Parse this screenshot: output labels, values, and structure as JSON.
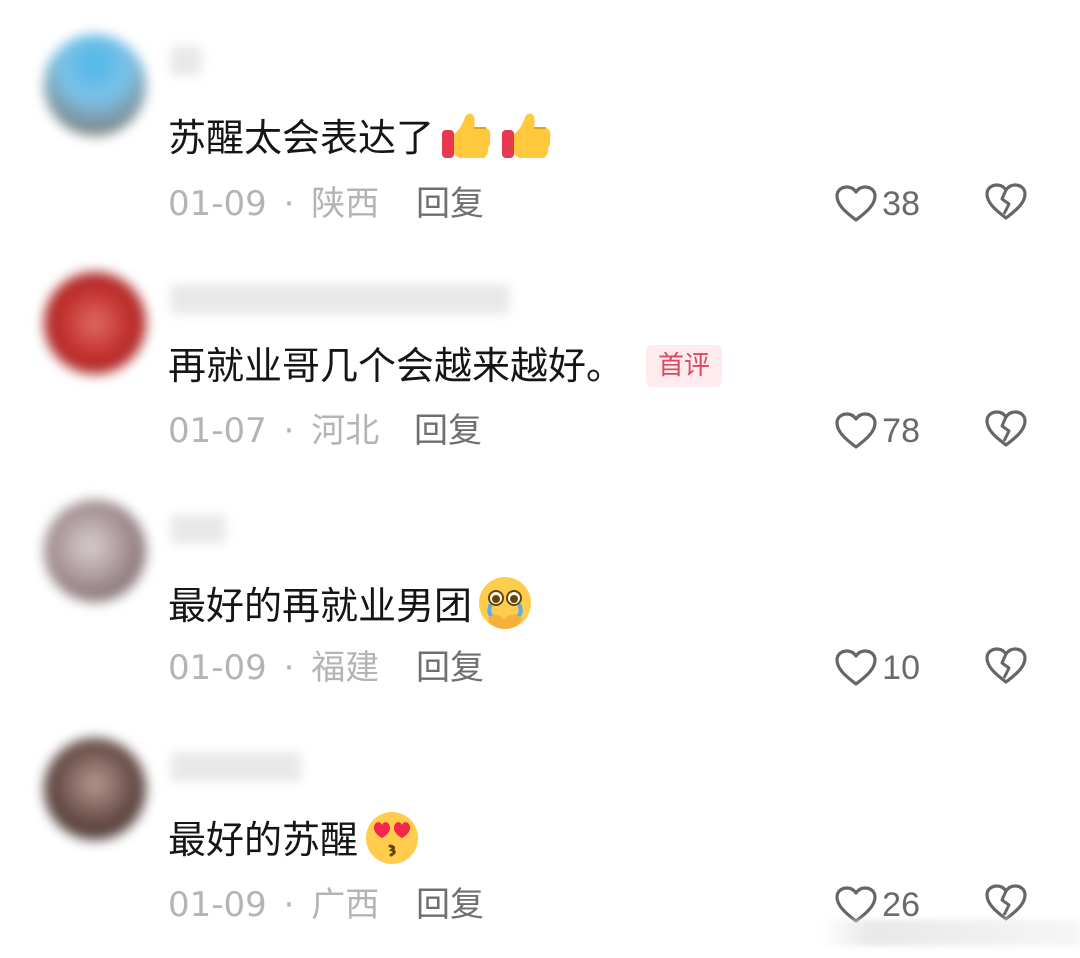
{
  "comments": [
    {
      "text": "苏醒太会表达了",
      "emojis": [
        "thumbs-up",
        "thumbs-up"
      ],
      "date": "01-09",
      "separator": "·",
      "location": "陕西",
      "reply_label": "回复",
      "likes": "38",
      "avatar_color": "#6ea3c7",
      "badge": ""
    },
    {
      "text": "再就业哥几个会越来越好。",
      "emojis": [],
      "date": "01-07",
      "separator": "·",
      "location": "河北",
      "reply_label": "回复",
      "likes": "78",
      "avatar_color": "#b0262a",
      "badge": "首评"
    },
    {
      "text": "最好的再就业男团",
      "emojis": [
        "pleading-face"
      ],
      "date": "01-09",
      "separator": "·",
      "location": "福建",
      "reply_label": "回复",
      "likes": "10",
      "avatar_color": "#9a8a8c",
      "badge": ""
    },
    {
      "text": "最好的苏醒",
      "emojis": [
        "kissing-heart-face"
      ],
      "date": "01-09",
      "separator": "·",
      "location": "广西",
      "reply_label": "回复",
      "likes": "26",
      "avatar_color": "#6b4f49",
      "badge": ""
    }
  ],
  "icons": {
    "like": "heart-outline-icon",
    "dislike": "broken-heart-icon"
  },
  "colors": {
    "badge_text": "#e0475f",
    "badge_bg": "#fdebee",
    "meta_text": "#b4b4b4"
  }
}
